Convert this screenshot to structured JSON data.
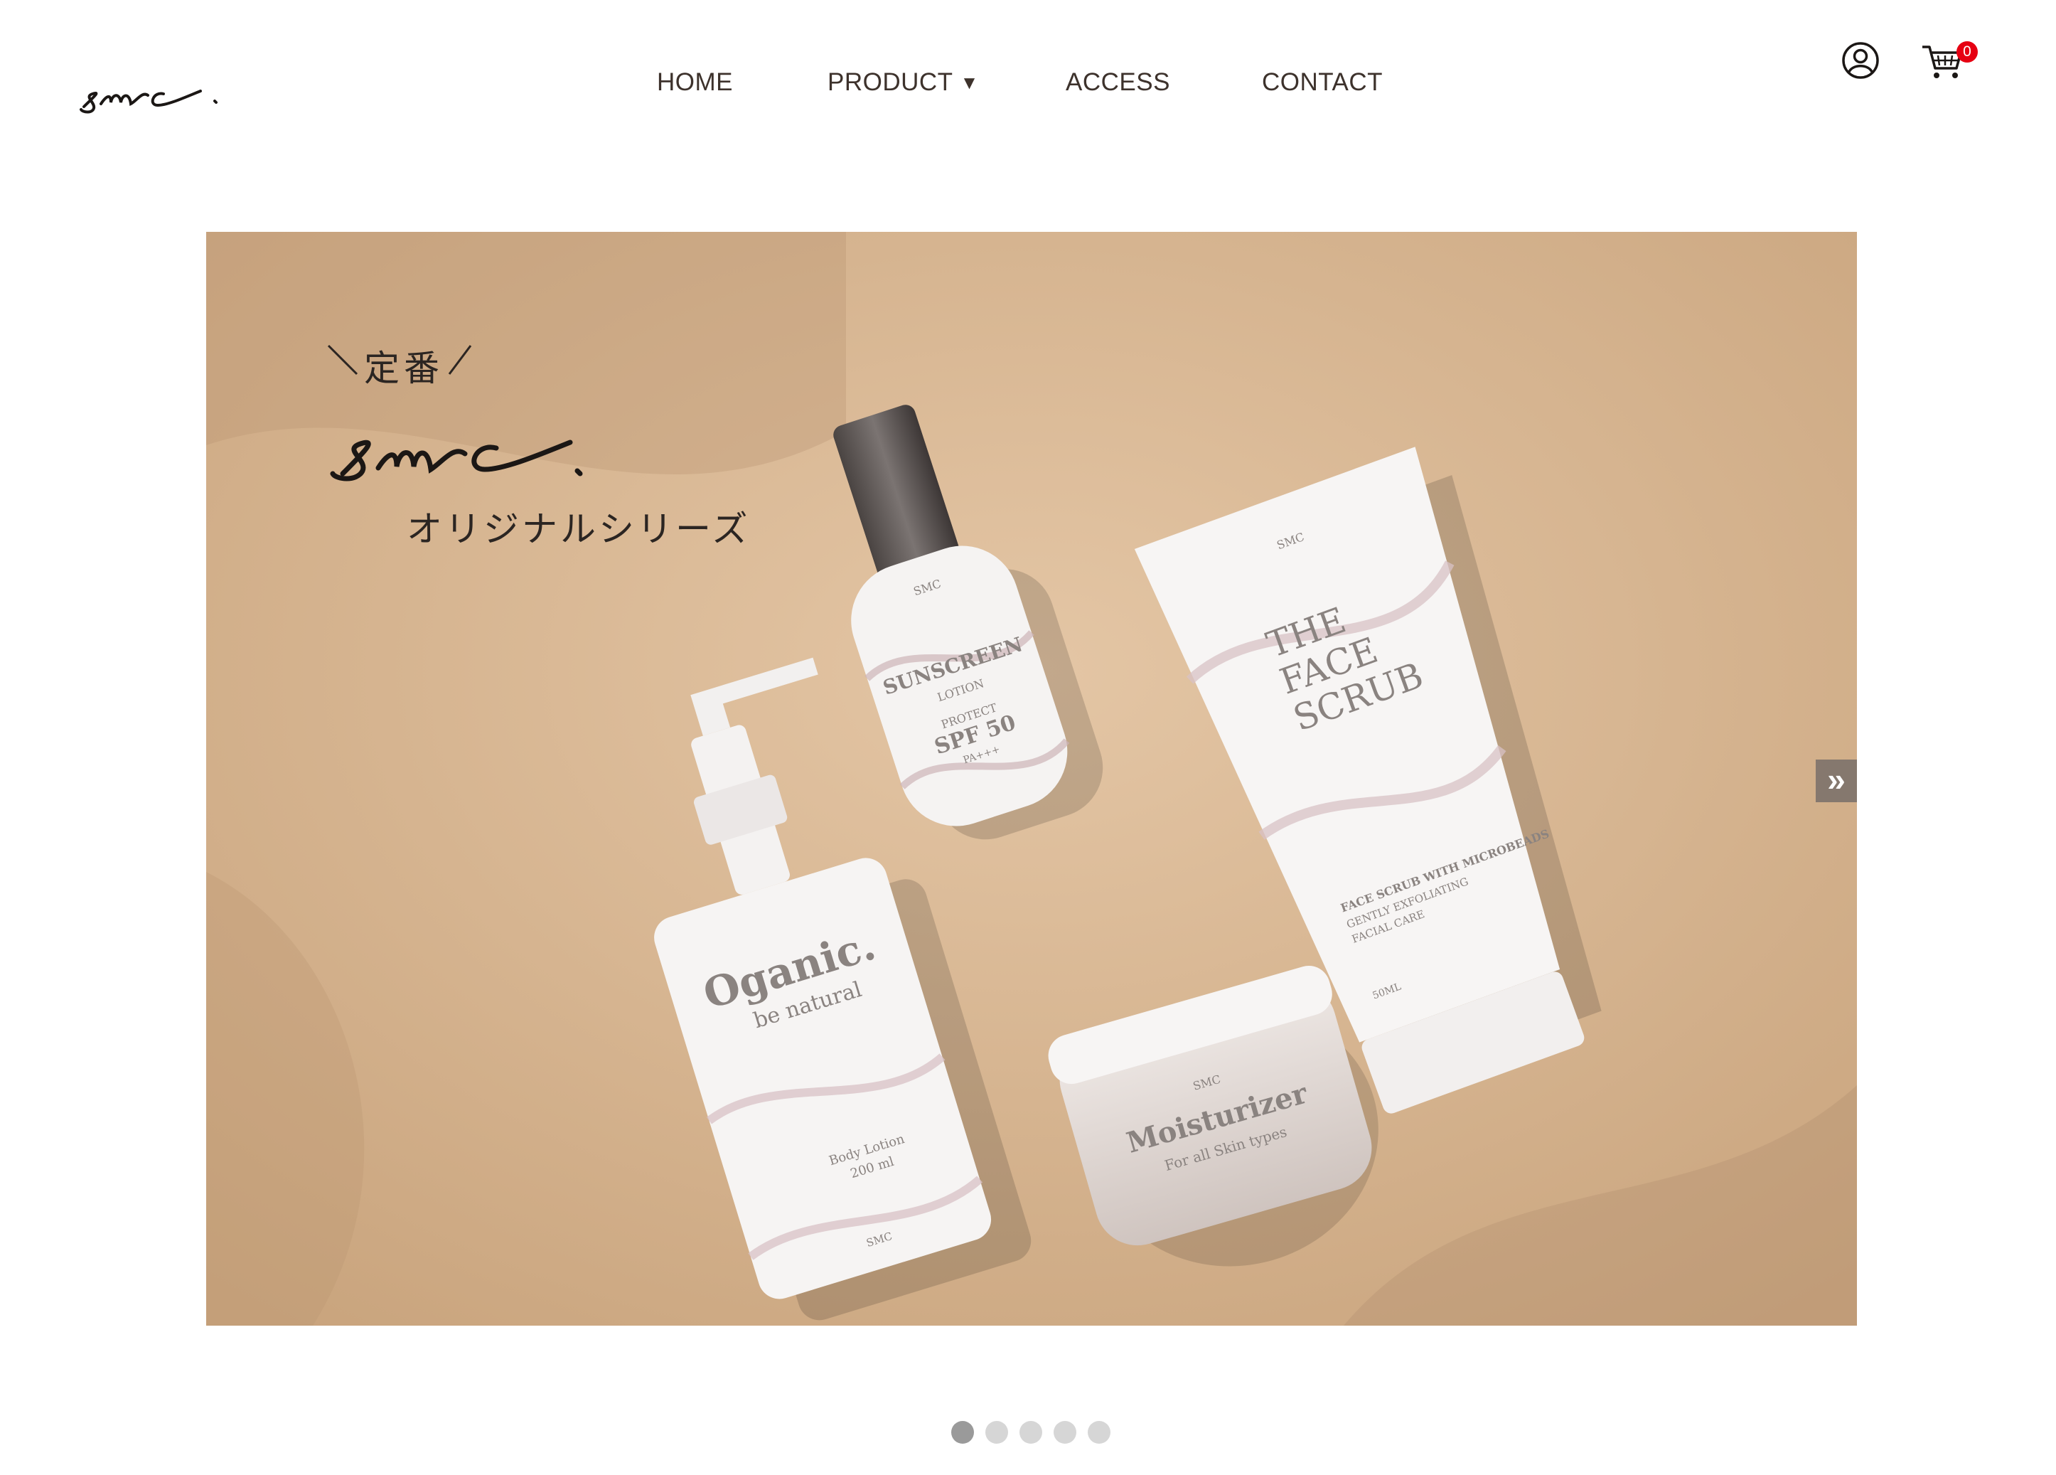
{
  "header": {
    "logo_text": "smc.",
    "nav": [
      {
        "label": "HOME"
      },
      {
        "label": "PRODUCT",
        "caret": "▼"
      },
      {
        "label": "ACCESS"
      },
      {
        "label": "CONTACT"
      }
    ],
    "cart_count": "0",
    "icons": {
      "account": "user-circle-icon",
      "cart": "shopping-cart-icon"
    },
    "badge_color": "#e60012"
  },
  "hero": {
    "tagline_top": "定番",
    "brand_script": "smc.",
    "tagline_bottom": "オリジナルシリーズ",
    "next_arrow": "»",
    "products": {
      "sunscreen": {
        "brand": "SMC",
        "name": "SUNSCREEN",
        "sub": "LOTION",
        "protect": "PROTECT",
        "spf": "SPF 50",
        "pa": "PA+++"
      },
      "scrub": {
        "brand": "SMC",
        "line1": "THE",
        "line2": "FACE",
        "line3": "SCRUB",
        "desc1": "FACE SCRUB WITH MICROBEADS",
        "desc2": "GENTLY EXFOLIATING",
        "desc3": "FACIAL CARE",
        "volume": "50ML"
      },
      "lotion": {
        "name": "Oganic.",
        "tagline": "be natural",
        "type": "Body Lotion",
        "volume": "200 ml",
        "brand": "SMC"
      },
      "moisturizer": {
        "brand": "SMC",
        "name": "Moisturizer",
        "sub": "For all Skin types"
      }
    }
  },
  "slider": {
    "slide_count": 5,
    "active_index": 0
  },
  "colors": {
    "sand": "#d9b996",
    "text": "#3d322c",
    "active_dot": "#9a9a9a",
    "inactive_dot": "#d6d6d6"
  }
}
